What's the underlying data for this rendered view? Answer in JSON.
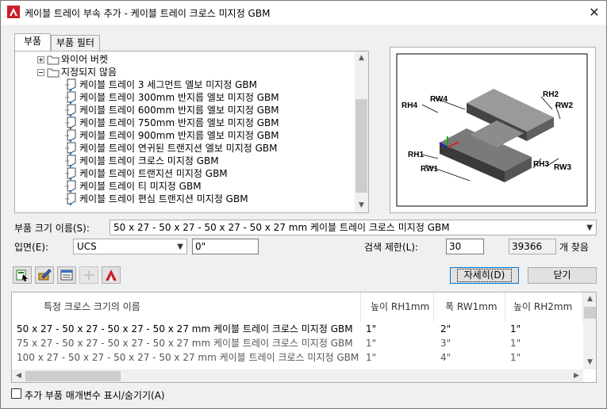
{
  "window": {
    "title": "케이블 트레이 부속 추가 - 케이블 트레이 크로스 미지정 GBM",
    "close_glyph": "✕"
  },
  "tabs": [
    {
      "label": "부품"
    },
    {
      "label": "부품 필터"
    }
  ],
  "tree": {
    "items": [
      {
        "label": "와이어 버켓",
        "type": "folder",
        "expanded": false
      },
      {
        "label": "지정되지 않음",
        "type": "folder",
        "expanded": true
      },
      {
        "label": "케이블 트레이 3 세그먼트 엘보 미지정 GBM",
        "type": "part"
      },
      {
        "label": "케이블 트레이 300mm 반지름 엘보 미지정 GBM",
        "type": "part"
      },
      {
        "label": "케이블 트레이 600mm 반지름 엘보 미지정 GBM",
        "type": "part"
      },
      {
        "label": "케이블 트레이 750mm 반지름 엘보 미지정 GBM",
        "type": "part"
      },
      {
        "label": "케이블 트레이 900mm 반지름 엘보 미지정 GBM",
        "type": "part"
      },
      {
        "label": "케이블 트레이 연귀된 트랜지션 엘보 미지정 GBM",
        "type": "part"
      },
      {
        "label": "케이블 트레이 크로스 미지정 GBM",
        "type": "part"
      },
      {
        "label": "케이블 트레이 트랜지션 미지정 GBM",
        "type": "part"
      },
      {
        "label": "케이블 트레이 티 미지정 GBM",
        "type": "part"
      },
      {
        "label": "케이블 트레이 편심 트랜지션 미지정 GBM",
        "type": "part"
      }
    ]
  },
  "preview": {
    "labels": [
      "RH4",
      "RW4",
      "RH2",
      "RW2",
      "RH1",
      "RW1",
      "RH3",
      "RW3"
    ]
  },
  "part_size": {
    "label": "부품 크기 이름(S):",
    "value": "50 x 27 - 50 x 27 - 50 x 27 - 50 x 27 mm 케이블 트레이 크로스 미지정 GBM"
  },
  "elevation": {
    "label": "입면(E):",
    "ucs_value": "UCS",
    "offset_value": "0\""
  },
  "search": {
    "label": "검색 제한(L):",
    "limit_value": "30",
    "found_count": "39366",
    "found_suffix": "개 찾음"
  },
  "buttons": {
    "details": "자세히(D)",
    "close": "닫기"
  },
  "grid": {
    "columns": [
      "특정 크로스 크기의 이름",
      "높이 RH1mm",
      "폭 RW1mm",
      "높이 RH2mm"
    ],
    "rows": [
      [
        "50 x 27 - 50 x 27 - 50 x 27 - 50 x 27 mm 케이블 트레이 크로스 미지정 GBM",
        "1\"",
        "2\"",
        "1\""
      ],
      [
        "75 x 27 - 50 x 27 - 50 x 27 - 50 x 27 mm 케이블 트레이 크로스 미지정 GBM",
        "1\"",
        "3\"",
        "1\""
      ],
      [
        "100 x 27 - 50 x 27 - 50 x 27 - 50 x 27 mm 케이블 트레이 크로스 미지정 GBM",
        "1\"",
        "4\"",
        "1\""
      ]
    ]
  },
  "show_params": {
    "label": "추가 부품 매개변수 표시/숨기기(A)",
    "checked": false
  },
  "colors": {
    "selection_accent": "#0078d7",
    "app_red": "#c8202a",
    "window_bg": "#f0f0f0"
  }
}
